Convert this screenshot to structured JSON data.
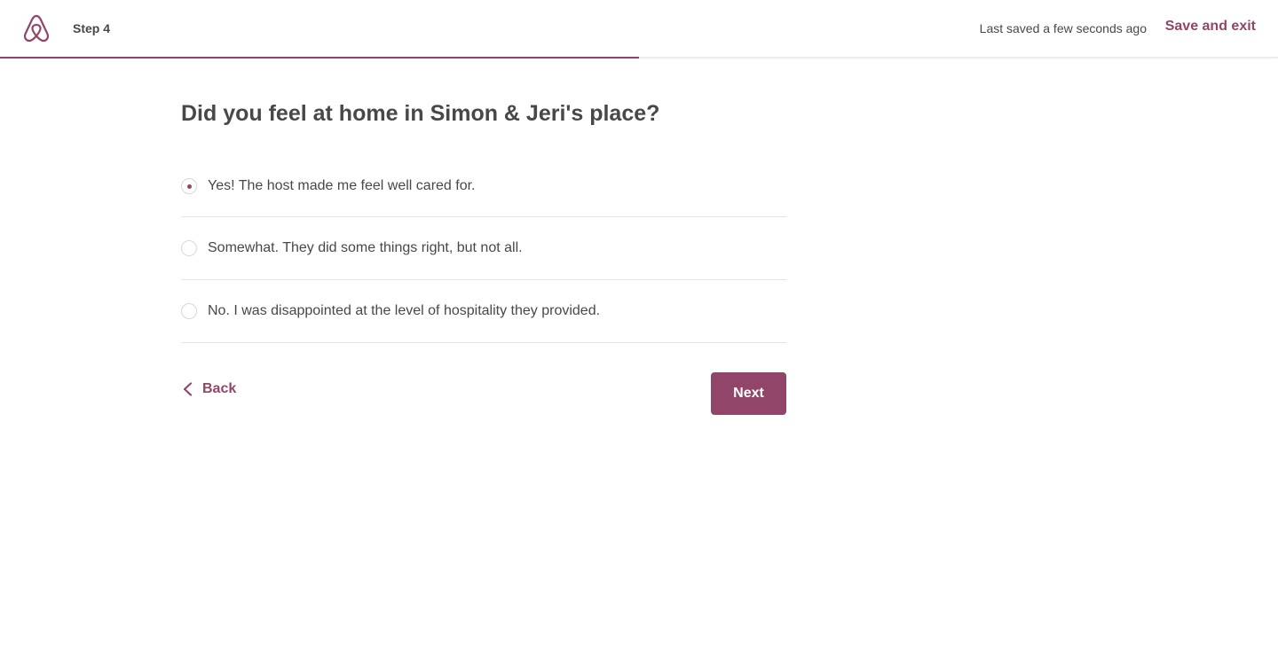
{
  "header": {
    "step_label": "Step 4",
    "saved_status": "Last saved a few seconds ago",
    "save_exit_label": "Save and exit",
    "logo_icon": "airbnb-belo-icon"
  },
  "progress": {
    "fraction": 0.5
  },
  "question": {
    "title": "Did you feel at home in Simon & Jeri's place?",
    "options": [
      {
        "label": "Yes! The host made me feel well cared for.",
        "selected": true
      },
      {
        "label": "Somewhat. They did some things right, but not all.",
        "selected": false
      },
      {
        "label": "No. I was disappointed at the level of hospitality they provided.",
        "selected": false
      }
    ]
  },
  "navigation": {
    "back_label": "Back",
    "back_icon": "chevron-left-icon",
    "next_label": "Next"
  },
  "colors": {
    "brand": "#914669",
    "text": "#484848",
    "divider": "#e4e4e4"
  }
}
